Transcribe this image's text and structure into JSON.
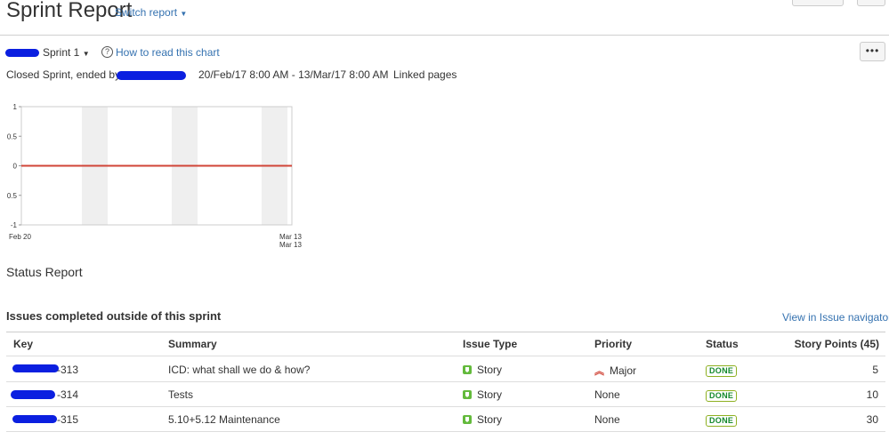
{
  "header": {
    "title": "Sprint Report",
    "switch_report": "Switch report"
  },
  "sprint": {
    "name": "Sprint 1",
    "help_link": "How to read this chart",
    "more": "•••",
    "closed_prefix": "Closed Sprint, ended by",
    "dates": "20/Feb/17 8:00 AM - 13/Mar/17 8:00 AM",
    "linked_pages": "Linked pages"
  },
  "chart_data": {
    "type": "line",
    "x_labels": {
      "start": "Feb 20",
      "end": "Mar 13",
      "end2": "Mar 13"
    },
    "y_ticks": [
      "1",
      "0.5",
      "0",
      "0.5",
      "-1"
    ],
    "ylim": [
      -1,
      1
    ],
    "series": [
      {
        "values": [
          0,
          0
        ],
        "color": "#d04437"
      }
    ],
    "weekend_bands": 3
  },
  "status_report": "Status Report",
  "issues": {
    "title": "Issues completed outside of this sprint",
    "navigator_link": "View in Issue navigator",
    "columns": [
      "Key",
      "Summary",
      "Issue Type",
      "Priority",
      "Status",
      "Story Points (45)"
    ],
    "rows": [
      {
        "key": "-313",
        "summary": "ICD: what shall we do & how?",
        "type": "Story",
        "priority": "Major",
        "priority_icon": "double-chevron-up-icon",
        "status": "DONE",
        "points": "5"
      },
      {
        "key": "-314",
        "summary": "Tests",
        "type": "Story",
        "priority": "None",
        "priority_icon": "",
        "status": "DONE",
        "points": "10"
      },
      {
        "key": "-315",
        "summary": "5.10+5.12 Maintenance",
        "type": "Story",
        "priority": "None",
        "priority_icon": "",
        "status": "DONE",
        "points": "30"
      }
    ]
  },
  "colors": {
    "link": "#3572b0",
    "redaction": "#0b1fe0",
    "chart_line": "#d04437",
    "done": "#14892c",
    "story": "#63ba3c"
  }
}
